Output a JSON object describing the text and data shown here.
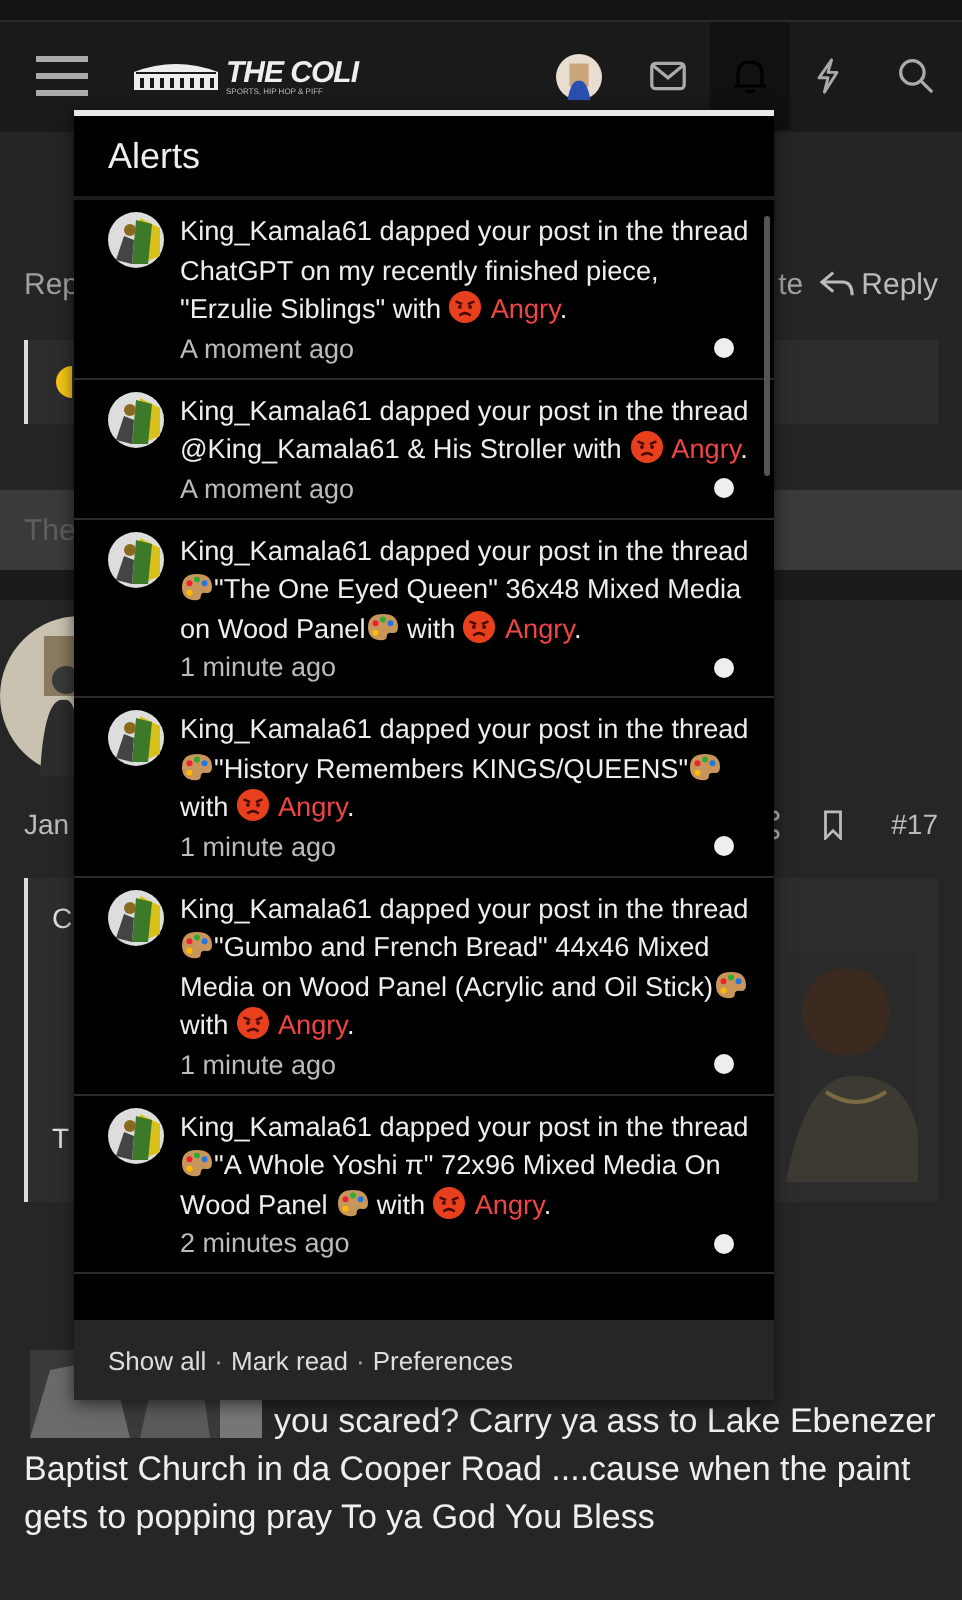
{
  "header": {
    "logo_title": "THE COLI",
    "logo_tagline": "SPORTS, HIP HOP & PIFF"
  },
  "background": {
    "reply_left": "Rep",
    "quote_action": "te",
    "reply": "Reply",
    "band_text": "The",
    "post_date": "Jan",
    "post_number": "#17",
    "quote_line_1": "C",
    "quote_line_2": "T",
    "paragraph": "you scared? Carry ya ass to Lake Ebenezer Baptist Church in da Cooper Road ....cause when the paint gets to popping pray To ya God You Bless"
  },
  "alerts": {
    "title": "Alerts",
    "items": [
      {
        "segments": [
          {
            "kind": "text",
            "text": "King_Kamala61 dapped your post in the thread ChatGPT on my recently finished piece, \"Erzulie Siblings\" with "
          },
          {
            "kind": "angry"
          },
          {
            "kind": "reaction",
            "text": "Angry"
          },
          {
            "kind": "text",
            "text": "."
          }
        ],
        "time": "A moment ago",
        "unread": true
      },
      {
        "segments": [
          {
            "kind": "text",
            "text": "King_Kamala61 dapped your post in the thread @King_Kamala61 & His Stroller with "
          },
          {
            "kind": "angry"
          },
          {
            "kind": "reaction",
            "text": "Angry"
          },
          {
            "kind": "text",
            "text": "."
          }
        ],
        "time": "A moment ago",
        "unread": true
      },
      {
        "segments": [
          {
            "kind": "text",
            "text": "King_Kamala61 dapped your post in the thread "
          },
          {
            "kind": "palette"
          },
          {
            "kind": "text",
            "text": "\"The One Eyed Queen\" 36x48 Mixed Media on Wood Panel"
          },
          {
            "kind": "palette"
          },
          {
            "kind": "text",
            "text": " with "
          },
          {
            "kind": "angry"
          },
          {
            "kind": "reaction",
            "text": "Angry"
          },
          {
            "kind": "text",
            "text": "."
          }
        ],
        "time": "1 minute ago",
        "unread": true
      },
      {
        "segments": [
          {
            "kind": "text",
            "text": "King_Kamala61 dapped your post in the thread "
          },
          {
            "kind": "palette"
          },
          {
            "kind": "text",
            "text": "\"History Remembers KINGS/QUEENS\""
          },
          {
            "kind": "palette"
          },
          {
            "kind": "text",
            "text": " with "
          },
          {
            "kind": "angry"
          },
          {
            "kind": "reaction",
            "text": "Angry"
          },
          {
            "kind": "text",
            "text": "."
          }
        ],
        "time": "1 minute ago",
        "unread": true
      },
      {
        "segments": [
          {
            "kind": "text",
            "text": "King_Kamala61 dapped your post in the thread "
          },
          {
            "kind": "palette"
          },
          {
            "kind": "text",
            "text": "\"Gumbo and French Bread\" 44x46 Mixed Media on Wood Panel (Acrylic and Oil Stick)"
          },
          {
            "kind": "palette"
          },
          {
            "kind": "text",
            "text": " with "
          },
          {
            "kind": "angry"
          },
          {
            "kind": "reaction",
            "text": "Angry"
          },
          {
            "kind": "text",
            "text": "."
          }
        ],
        "time": "1 minute ago",
        "unread": true
      },
      {
        "segments": [
          {
            "kind": "text",
            "text": "King_Kamala61 dapped your post in the thread "
          },
          {
            "kind": "palette"
          },
          {
            "kind": "text",
            "text": "\"A Whole Yoshi π\" 72x96 Mixed Media On Wood Panel "
          },
          {
            "kind": "palette"
          },
          {
            "kind": "text",
            "text": " with "
          },
          {
            "kind": "angry"
          },
          {
            "kind": "reaction",
            "text": "Angry"
          },
          {
            "kind": "text",
            "text": "."
          }
        ],
        "time": "2 minutes ago",
        "unread": true
      }
    ],
    "footer_links": [
      "Show all",
      "Mark read",
      "Preferences"
    ],
    "separator": "·"
  }
}
